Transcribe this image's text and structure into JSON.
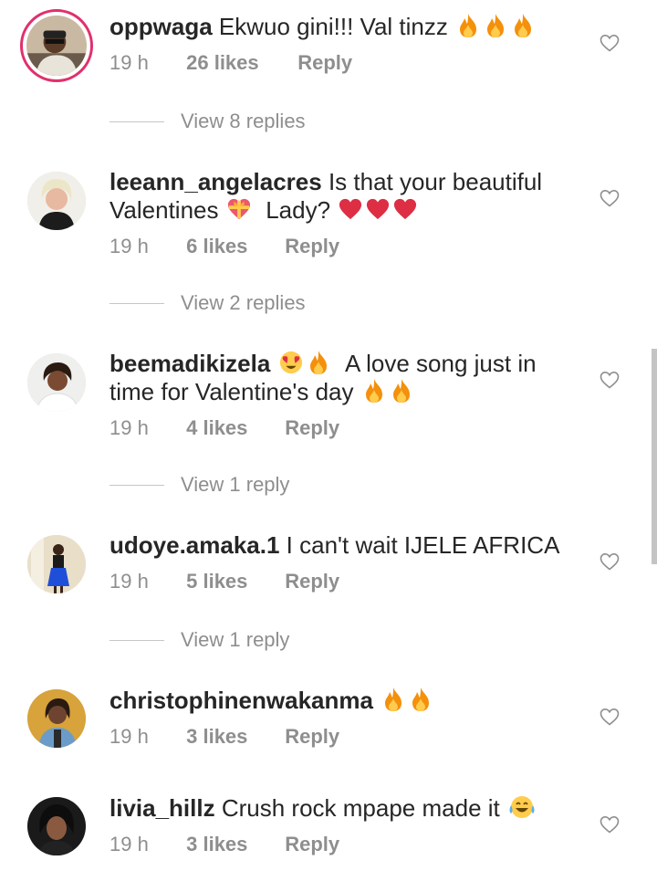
{
  "comments": [
    {
      "username": "oppwaga",
      "text": "Ekwuo gini!!! Val tinzz",
      "time": "19 h",
      "likes": "26 likes",
      "reply": "Reply",
      "view_replies": "View 8 replies"
    },
    {
      "username": "leeann_angelacres",
      "text_part1": "Is that your beautiful Valentines",
      "text_part2": "Lady?",
      "time": "19 h",
      "likes": "6 likes",
      "reply": "Reply",
      "view_replies": "View 2 replies"
    },
    {
      "username": "beemadikizela",
      "text_part1": "A love song just in time for Valentine's day",
      "time": "19 h",
      "likes": "4 likes",
      "reply": "Reply",
      "view_replies": "View 1 reply"
    },
    {
      "username": "udoye.amaka.1",
      "text": "I can't wait IJELE AFRICA",
      "time": "19 h",
      "likes": "5 likes",
      "reply": "Reply",
      "view_replies": "View 1 reply"
    },
    {
      "username": "christophinenwakanma",
      "text": "",
      "time": "19 h",
      "likes": "3 likes",
      "reply": "Reply"
    },
    {
      "username": "livia_hillz",
      "text": "Crush rock mpape made it",
      "time": "19 h",
      "likes": "3 likes",
      "reply": "Reply"
    }
  ],
  "icons": {
    "like": "heart-outline-icon",
    "fire": "fire-emoji",
    "heart": "red-heart-emoji",
    "gift_heart": "heart-with-ribbon-emoji",
    "heart_eyes": "heart-eyes-emoji",
    "joy": "tears-of-joy-emoji"
  },
  "colors": {
    "text": "#262626",
    "meta": "#8e8e8e",
    "story_ring": "#e1306c"
  }
}
